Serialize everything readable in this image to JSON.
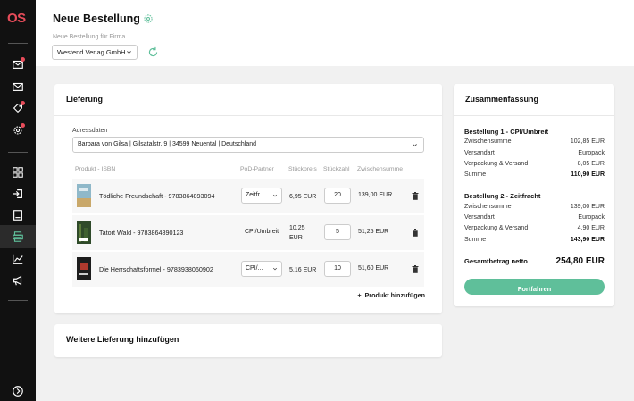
{
  "app": {
    "logo": "OS"
  },
  "header": {
    "title": "Neue Bestellung",
    "firm_label": "Neue Bestellung für Firma",
    "firm_value": "Westend Verlag GmbH"
  },
  "delivery": {
    "title": "Lieferung",
    "address_label": "Adressdaten",
    "address_value": "Barbara von Gilsa | Gilsatalstr. 9 | 34599 Neuental | Deutschland",
    "columns": {
      "product": "Produkt - ISBN",
      "partner": "PoD-Partner",
      "price": "Stückpreis",
      "qty": "Stückzahl",
      "subtotal": "Zwischensumme"
    },
    "rows": [
      {
        "name": "Tödliche Freundschaft - 9783864893094",
        "partner": "Zeitfr...",
        "price": "6,95 EUR",
        "qty": "20",
        "subtotal": "139,00 EUR"
      },
      {
        "name": "Tatort Wald - 9783864890123",
        "partner": "CPI/Umbreit",
        "price": "10,25 EUR",
        "qty": "5",
        "subtotal": "51,25 EUR"
      },
      {
        "name": "Die Herrschaftsformel - 9783938060902",
        "partner": "CPI/...",
        "price": "5,16 EUR",
        "qty": "10",
        "subtotal": "51,60 EUR"
      }
    ],
    "add_product": "Produkt hinzufügen"
  },
  "another_delivery": {
    "title": "Weitere Lieferung hinzufügen"
  },
  "summary": {
    "title": "Zusammenfassung",
    "orders": [
      {
        "title": "Bestellung 1 - CPI/Umbreit",
        "lines": [
          {
            "label": "Zwischensumme",
            "value": "102,85 EUR"
          },
          {
            "label": "Versandart",
            "value": "Europack"
          },
          {
            "label": "Verpackung & Versand",
            "value": "8,05 EUR"
          },
          {
            "label": "Summe",
            "value": "110,90 EUR"
          }
        ]
      },
      {
        "title": "Bestellung 2 - Zeitfracht",
        "lines": [
          {
            "label": "Zwischensumme",
            "value": "139,00 EUR"
          },
          {
            "label": "Versandart",
            "value": "Europack"
          },
          {
            "label": "Verpackung & Versand",
            "value": "4,90 EUR"
          },
          {
            "label": "Summe",
            "value": "143,90 EUR"
          }
        ]
      }
    ],
    "grand_total_label": "Gesamtbetrag netto",
    "grand_total_value": "254,80 EUR",
    "continue_label": "Fortfahren"
  },
  "colors": {
    "accent": "#5fbf9a",
    "notification": "#e84c5a",
    "sidebar": "#111111"
  }
}
